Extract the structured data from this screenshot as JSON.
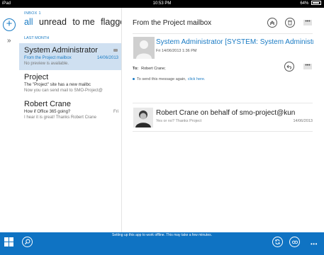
{
  "status": {
    "device": "iPad",
    "time": "10:53 PM",
    "battery": "64%"
  },
  "rail": {
    "compose_glyph": "+",
    "expand_glyph": "»"
  },
  "list": {
    "folder": "INBOX 1",
    "filters": [
      "all",
      "unread",
      "to me",
      "flagged"
    ],
    "active_filter": "all",
    "group": "LAST MONTH",
    "messages": [
      {
        "from": "System Administrator",
        "subject": "From the Project mailbox",
        "preview": "No preview is available.",
        "date": "14/06/2013",
        "selected": true
      },
      {
        "from": "Project",
        "subject": "The \"Project\" site has a new mailbc",
        "preview": "Now you can send mail to SMO-Project@",
        "date": "",
        "selected": false
      },
      {
        "from": "Robert Crane",
        "subject": "How if Office 365 going?",
        "preview": "I hear it is great!  Thanks Robert Crane",
        "date": "Fri",
        "selected": false
      }
    ]
  },
  "pane": {
    "title": "From the Project mailbox",
    "actions": {
      "up_icon": "reply-all-icon",
      "delete_icon": "trash-icon",
      "more": "•••"
    },
    "message1": {
      "sender": "System Administrator [SYSTEM: System Administrato",
      "sent": "Fri 14/06/2013 1:36 PM",
      "to_label": "To:",
      "to": "Robert Crane;",
      "resend_text": "To send this message again,",
      "resend_link": "click here."
    },
    "message2": {
      "sender": "Robert Crane on behalf of smo-project@kun",
      "preview": "Yes or no? Thanks Project",
      "date": "14/06/2013"
    }
  },
  "appbar": {
    "message": "Setting up this app to work offline. This may take a few minutes.",
    "more": "•••"
  },
  "colors": {
    "accent": "#1a7bc4",
    "appbar": "#0f73c3",
    "selected_row": "#cfe0f1"
  }
}
